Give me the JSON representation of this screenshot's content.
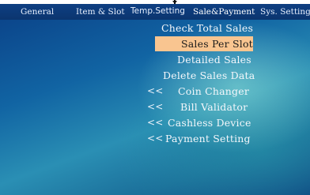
{
  "tabs": [
    {
      "label": "General"
    },
    {
      "label": "Item & Slot"
    },
    {
      "label": "Temp.Setting"
    },
    {
      "label": "Sale&Payment"
    },
    {
      "label": "Sys. Setting"
    }
  ],
  "menu": {
    "items": [
      {
        "label": "Check Total Sales",
        "chevron": ""
      },
      {
        "label": "Sales Per Slot",
        "chevron": "",
        "selected": true
      },
      {
        "label": "Detailed Sales",
        "chevron": ""
      },
      {
        "label": "Delete Sales Data",
        "chevron": ""
      },
      {
        "label": "Coin Changer",
        "chevron": "<<"
      },
      {
        "label": "Bill Validator",
        "chevron": "<<"
      },
      {
        "label": "Cashless Device",
        "chevron": "<<"
      },
      {
        "label": "Payment Setting",
        "chevron": "<<"
      }
    ]
  },
  "colors": {
    "highlight": "#f9c590",
    "tabbar": "#0e3f83"
  }
}
